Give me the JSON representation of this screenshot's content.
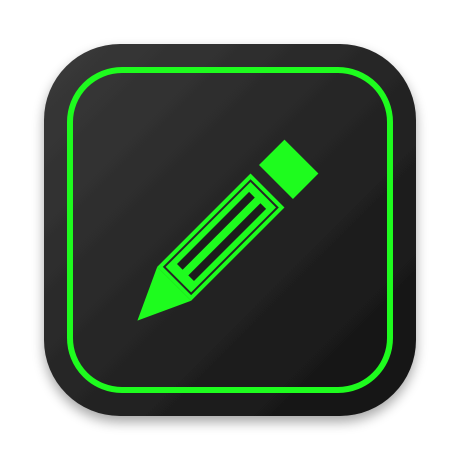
{
  "icon": {
    "name": "pencil-app-icon",
    "glyph": "pencil-icon",
    "colors": {
      "background": "#ffffff",
      "tile_light": "#3a3a3a",
      "tile_dark": "#111111",
      "accent": "#1efc1e"
    }
  }
}
